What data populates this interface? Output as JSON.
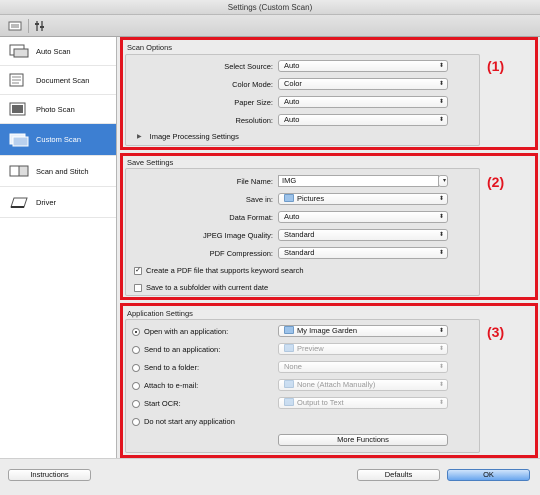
{
  "window": {
    "title": "Settings (Custom Scan)"
  },
  "toolbar": {
    "icons": [
      "scan-from-computer-icon",
      "scan-from-panel-icon"
    ]
  },
  "sidebar": {
    "items": [
      {
        "label": "Auto Scan"
      },
      {
        "label": "Document Scan"
      },
      {
        "label": "Photo Scan"
      },
      {
        "label": "Custom Scan",
        "selected": true
      },
      {
        "label": "Scan and Stitch"
      },
      {
        "label": "Driver"
      }
    ]
  },
  "scan_options": {
    "title": "Scan Options",
    "marker": "(1)",
    "fields": [
      {
        "label": "Select Source:",
        "value": "Auto"
      },
      {
        "label": "Color Mode:",
        "value": "Color"
      },
      {
        "label": "Paper Size:",
        "value": "Auto"
      },
      {
        "label": "Resolution:",
        "value": "Auto"
      }
    ],
    "expander": "Image Processing Settings"
  },
  "save_settings": {
    "title": "Save Settings",
    "marker": "(2)",
    "file_name_label": "File Name:",
    "file_name_value": "IMG",
    "save_in_label": "Save in:",
    "save_in_value": "Pictures",
    "fields": [
      {
        "label": "Data Format:",
        "value": "Auto"
      },
      {
        "label": "JPEG Image Quality:",
        "value": "Standard"
      },
      {
        "label": "PDF Compression:",
        "value": "Standard"
      }
    ],
    "checkboxes": [
      {
        "label": "Create a PDF file that supports keyword search",
        "checked": true
      },
      {
        "label": "Save to a subfolder with current date",
        "checked": false
      }
    ]
  },
  "app_settings": {
    "title": "Application Settings",
    "marker": "(3)",
    "options": [
      {
        "label": "Open with an application:",
        "value": "My Image Garden",
        "checked": true,
        "enabled": true
      },
      {
        "label": "Send to an application:",
        "value": "Preview",
        "checked": false,
        "enabled": false
      },
      {
        "label": "Send to a folder:",
        "value": "None",
        "checked": false,
        "enabled": false
      },
      {
        "label": "Attach to e-mail:",
        "value": "None (Attach Manually)",
        "checked": false,
        "enabled": false
      },
      {
        "label": "Start OCR:",
        "value": "Output to Text",
        "checked": false,
        "enabled": false
      },
      {
        "label": "Do not start any application",
        "checked": false
      }
    ],
    "more_button": "More Functions"
  },
  "footer": {
    "instructions": "Instructions",
    "defaults": "Defaults",
    "ok": "OK"
  },
  "colors": {
    "highlight": "#e2141f",
    "selection": "#3d7fd2"
  }
}
